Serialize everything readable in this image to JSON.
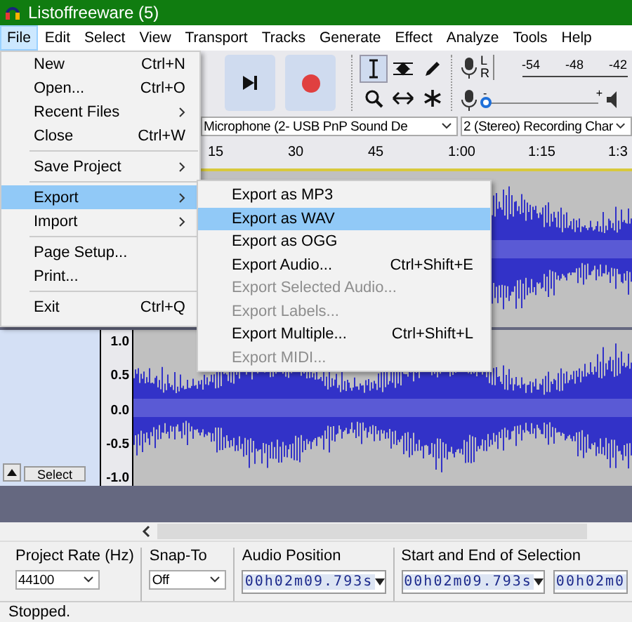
{
  "window": {
    "title": "Listoffreeware (5)"
  },
  "menu_bar": [
    {
      "label": "File",
      "selected": true
    },
    {
      "label": "Edit",
      "selected": false
    },
    {
      "label": "Select",
      "selected": false
    },
    {
      "label": "View",
      "selected": false
    },
    {
      "label": "Transport",
      "selected": false
    },
    {
      "label": "Tracks",
      "selected": false
    },
    {
      "label": "Generate",
      "selected": false
    },
    {
      "label": "Effect",
      "selected": false
    },
    {
      "label": "Analyze",
      "selected": false
    },
    {
      "label": "Tools",
      "selected": false
    },
    {
      "label": "Help",
      "selected": false
    }
  ],
  "file_menu": [
    {
      "kind": "item",
      "label": "New",
      "shortcut": "Ctrl+N",
      "selected": false
    },
    {
      "kind": "item",
      "label": "Open...",
      "shortcut": "Ctrl+O",
      "selected": false
    },
    {
      "kind": "submenu",
      "label": "Recent Files",
      "selected": false
    },
    {
      "kind": "item",
      "label": "Close",
      "shortcut": "Ctrl+W",
      "selected": false
    },
    {
      "kind": "separator"
    },
    {
      "kind": "submenu",
      "label": "Save Project",
      "selected": false
    },
    {
      "kind": "separator"
    },
    {
      "kind": "submenu",
      "label": "Export",
      "selected": true
    },
    {
      "kind": "submenu",
      "label": "Import",
      "selected": false
    },
    {
      "kind": "separator"
    },
    {
      "kind": "item",
      "label": "Page Setup...",
      "selected": false
    },
    {
      "kind": "item",
      "label": "Print...",
      "selected": false
    },
    {
      "kind": "separator"
    },
    {
      "kind": "item",
      "label": "Exit",
      "shortcut": "Ctrl+Q",
      "selected": false
    }
  ],
  "export_menu": [
    {
      "label": "Export as MP3",
      "disabled": false,
      "selected": false
    },
    {
      "label": "Export as WAV",
      "disabled": false,
      "selected": true
    },
    {
      "label": "Export as OGG",
      "disabled": false,
      "selected": false
    },
    {
      "label": "Export Audio...",
      "shortcut": "Ctrl+Shift+E",
      "disabled": false,
      "selected": false
    },
    {
      "label": "Export Selected Audio...",
      "disabled": true,
      "selected": false
    },
    {
      "label": "Export Labels...",
      "disabled": true,
      "selected": false
    },
    {
      "label": "Export Multiple...",
      "shortcut": "Ctrl+Shift+L",
      "disabled": false,
      "selected": false
    },
    {
      "label": "Export MIDI...",
      "disabled": true,
      "selected": false
    }
  ],
  "meters": {
    "channels": [
      "L",
      "R"
    ],
    "scale": [
      "-54",
      "-48",
      "-42"
    ],
    "slider_min": "-",
    "slider_max": "+",
    "input_volume": {
      "level": 0
    }
  },
  "devices": {
    "input": "Microphone (2- USB PnP Sound De",
    "channels": "2 (Stereo) Recording Char"
  },
  "timeline": {
    "ticks": [
      "15",
      "30",
      "45",
      "1:00",
      "1:15",
      "1:3"
    ]
  },
  "track": {
    "ruler": [
      "1.0",
      "0.5",
      "0.0",
      "-0.5",
      "-1.0"
    ],
    "select_button": "Select"
  },
  "selection_toolbar": {
    "project_rate": {
      "label": "Project Rate (Hz)",
      "value": "44100"
    },
    "snap_to": {
      "label": "Snap-To",
      "value": "Off"
    },
    "audio_position": {
      "label": "Audio Position",
      "value": "00h02m09.793s"
    },
    "selection": {
      "label": "Start and End of Selection",
      "start": "00h02m09.793s",
      "end": "00h02m0"
    }
  },
  "status_bar": "Stopped."
}
